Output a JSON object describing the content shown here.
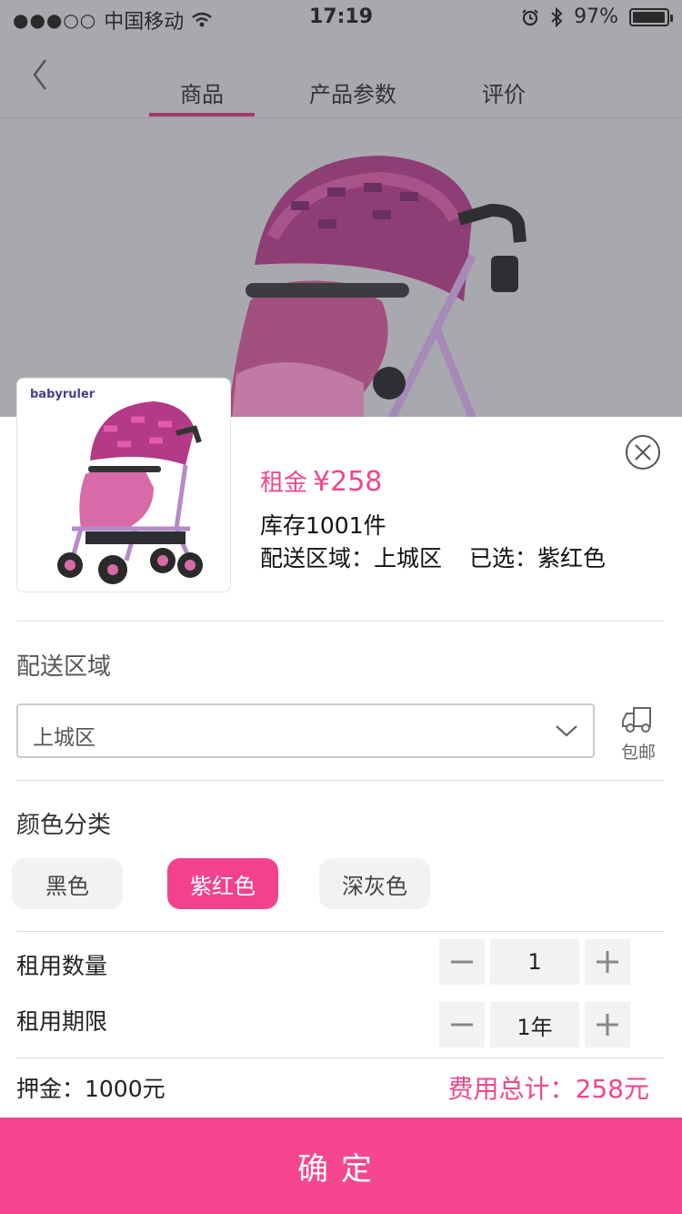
{
  "status_bar": {
    "signal": "●●●○○",
    "carrier": "中国移动",
    "time": "17:19",
    "battery_percent": "97%",
    "battery_level": 0.97
  },
  "nav": {
    "tabs": [
      {
        "label": "商品",
        "active": true
      },
      {
        "label": "产品参数",
        "active": false
      },
      {
        "label": "评价",
        "active": false
      }
    ]
  },
  "product": {
    "brand": "babyruler",
    "price_label": "租金",
    "price_amount": "¥258",
    "stock": "库存1001件",
    "delivery_summary": "配送区域：上城区",
    "selected_summary": "已选：紫红色"
  },
  "delivery": {
    "title": "配送区域",
    "selected": "上城区",
    "shipping_label": "包邮"
  },
  "colors": {
    "title": "颜色分类",
    "options": [
      {
        "label": "黑色",
        "selected": false
      },
      {
        "label": "紫红色",
        "selected": true
      },
      {
        "label": "深灰色",
        "selected": false
      }
    ]
  },
  "quantity": {
    "label": "租用数量",
    "value": "1"
  },
  "period": {
    "label": "租用期限",
    "value": "1年"
  },
  "footer": {
    "deposit": "押金：1000元",
    "total": "费用总计：258元",
    "confirm": "确定"
  },
  "theme": {
    "accent": "#f4418e",
    "overlay": "#a8a9ae"
  }
}
